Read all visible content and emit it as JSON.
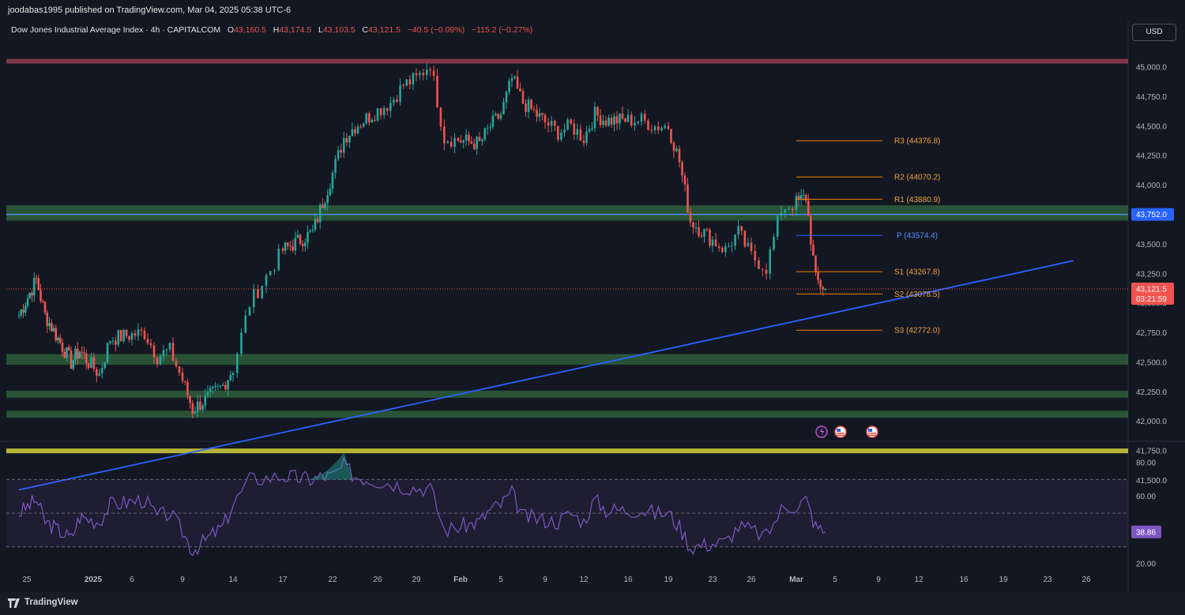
{
  "header": {
    "publisher": "joodabas1995 published on TradingView.com, Mar 04, 2025 05:38 UTC-6"
  },
  "legend": {
    "symbol": "Dow Jones Industrial Average Index · 4h · CAPITALCOM",
    "o_label": "O",
    "o": "43,160.5",
    "h_label": "H",
    "h": "43,174.5",
    "l_label": "L",
    "l": "43,103.5",
    "c_label": "C",
    "c": "43,121.5",
    "change": "−40.5 (−0.09%)",
    "change2": "−115.2 (−0.27%)"
  },
  "currency": "USD",
  "footer": {
    "brand": "TradingView"
  },
  "colors": {
    "up": "#26a69a",
    "down": "#ef5350",
    "trendline": "#2962ff",
    "pivot": "#f57c00",
    "rsi": "#7e57c2",
    "zone_green": "#2e5e3a",
    "zone_yellow": "#c8c43a",
    "zone_red": "#8a3a4a"
  },
  "chart_data": {
    "type": "candlestick",
    "timeframe": "4h",
    "price_axis": {
      "ticks": [
        "45,000.0",
        "44,750.0",
        "44,500.0",
        "44,250.0",
        "44,000.0",
        "43,750.0",
        "43,500.0",
        "43,250.0",
        "43,000.0",
        "42,750.0",
        "42,500.0",
        "42,250.0",
        "42,000.0",
        "41,750.0",
        "41,500.0"
      ],
      "range": [
        41450,
        45120
      ]
    },
    "time_axis": {
      "ticks": [
        "25",
        "2025",
        "6",
        "9",
        "14",
        "17",
        "22",
        "26",
        "29",
        "Feb",
        "5",
        "9",
        "12",
        "16",
        "19",
        "23",
        "26",
        "Mar",
        "5",
        "9",
        "12",
        "16",
        "19",
        "23",
        "26"
      ]
    },
    "last_price": {
      "label": "43,121.5",
      "countdown": "03:21:59",
      "value": 43121.5
    },
    "blue_line_label": {
      "label": "43,752.0",
      "value": 43752
    },
    "pivots": [
      {
        "label": "R3 (44376.8)",
        "value": 44376.8
      },
      {
        "label": "R2 (44070.2)",
        "value": 44070.2
      },
      {
        "label": "R1 (43880.9)",
        "value": 43880.9
      },
      {
        "label": "P (43574.4)",
        "value": 43574.4
      },
      {
        "label": "S1 (43267.8)",
        "value": 43267.8
      },
      {
        "label": "S2 (43078.5)",
        "value": 43078.5
      },
      {
        "label": "S3 (42772.0)",
        "value": 42772.0
      }
    ],
    "zones": [
      {
        "type": "resistance",
        "color": "red",
        "from": 45030,
        "to": 45070
      },
      {
        "type": "support",
        "color": "green",
        "from": 43700,
        "to": 43830
      },
      {
        "type": "support",
        "color": "green",
        "from": 42480,
        "to": 42570
      },
      {
        "type": "support",
        "color": "green",
        "from": 42200,
        "to": 42260
      },
      {
        "type": "support",
        "color": "green",
        "from": 42030,
        "to": 42090
      },
      {
        "type": "support",
        "color": "yellow",
        "from": 41730,
        "to": 41770
      }
    ],
    "trendline": {
      "from": {
        "date": "Dec 24, 2024",
        "price": 41420
      },
      "to": {
        "date": "Mar 25, 2025",
        "price": 43360
      }
    },
    "close_path": [
      [
        "Dec 24",
        42900
      ],
      [
        "Dec 26",
        43200
      ],
      [
        "Dec 27",
        42900
      ],
      [
        "Dec 30",
        42500
      ],
      [
        "Dec 31",
        42600
      ],
      [
        "Jan 2",
        42400
      ],
      [
        "Jan 3",
        42700
      ],
      [
        "Jan 6",
        42750
      ],
      [
        "Jan 7",
        42550
      ],
      [
        "Jan 8",
        42600
      ],
      [
        "Jan 10",
        42100
      ],
      [
        "Jan 13",
        42300
      ],
      [
        "Jan 14",
        42450
      ],
      [
        "Jan 15",
        43000
      ],
      [
        "Jan 17",
        43450
      ],
      [
        "Jan 20",
        43600
      ],
      [
        "Jan 21",
        43850
      ],
      [
        "Jan 22",
        44100
      ],
      [
        "Jan 23",
        44400
      ],
      [
        "Jan 24",
        44500
      ],
      [
        "Jan 27",
        44700
      ],
      [
        "Jan 28",
        44850
      ],
      [
        "Jan 29",
        44900
      ],
      [
        "Jan 30",
        45030
      ],
      [
        "Jan 31",
        44400
      ],
      [
        "Feb 3",
        44350
      ],
      [
        "Feb 4",
        44500
      ],
      [
        "Feb 5",
        44600
      ],
      [
        "Feb 6",
        44900
      ],
      [
        "Feb 7",
        44700
      ],
      [
        "Feb 10",
        44450
      ],
      [
        "Feb 11",
        44500
      ],
      [
        "Feb 12",
        44400
      ],
      [
        "Feb 13",
        44600
      ],
      [
        "Feb 14",
        44550
      ],
      [
        "Feb 17",
        44550
      ],
      [
        "Feb 18",
        44500
      ],
      [
        "Feb 19",
        44500
      ],
      [
        "Feb 20",
        44200
      ],
      [
        "Feb 21",
        43700
      ],
      [
        "Feb 24",
        43450
      ],
      [
        "Feb 25",
        43600
      ],
      [
        "Feb 26",
        43400
      ],
      [
        "Feb 27",
        43300
      ],
      [
        "Feb 28",
        43800
      ],
      [
        "Mar 2",
        43900
      ],
      [
        "Mar 3",
        43200
      ],
      [
        "Mar 4",
        43121.5
      ]
    ],
    "rsi": {
      "ticks": [
        "80.00",
        "60.00",
        "20.00"
      ],
      "range": [
        15,
        88
      ],
      "bands": {
        "upper": 70,
        "middle": 50,
        "lower": 30
      },
      "value_label": "38.86",
      "values": [
        [
          "Dec 24",
          50
        ],
        [
          "Dec 26",
          58
        ],
        [
          "Dec 27",
          45
        ],
        [
          "Dec 30",
          35
        ],
        [
          "Dec 31",
          48
        ],
        [
          "Jan 2",
          45
        ],
        [
          "Jan 3",
          55
        ],
        [
          "Jan 6",
          58
        ],
        [
          "Jan 7",
          48
        ],
        [
          "Jan 8",
          50
        ],
        [
          "Jan 10",
          28
        ],
        [
          "Jan 13",
          42
        ],
        [
          "Jan 14",
          55
        ],
        [
          "Jan 15",
          70
        ],
        [
          "Jan 17",
          72
        ],
        [
          "Jan 20",
          70
        ],
        [
          "Jan 21",
          72
        ],
        [
          "Jan 22",
          72
        ],
        [
          "Jan 23",
          78
        ],
        [
          "Jan 24",
          72
        ],
        [
          "Jan 27",
          68
        ],
        [
          "Jan 28",
          66
        ],
        [
          "Jan 29",
          65
        ],
        [
          "Jan 30",
          65
        ],
        [
          "Jan 31",
          40
        ],
        [
          "Feb 3",
          45
        ],
        [
          "Feb 4",
          52
        ],
        [
          "Feb 5",
          55
        ],
        [
          "Feb 6",
          62
        ],
        [
          "Feb 7",
          48
        ],
        [
          "Feb 10",
          45
        ],
        [
          "Feb 11",
          50
        ],
        [
          "Feb 12",
          45
        ],
        [
          "Feb 13",
          58
        ],
        [
          "Feb 14",
          52
        ],
        [
          "Feb 17",
          52
        ],
        [
          "Feb 18",
          50
        ],
        [
          "Feb 19",
          50
        ],
        [
          "Feb 20",
          42
        ],
        [
          "Feb 21",
          30
        ],
        [
          "Feb 24",
          33
        ],
        [
          "Feb 25",
          42
        ],
        [
          "Feb 26",
          40
        ],
        [
          "Feb 27",
          36
        ],
        [
          "Feb 28",
          52
        ],
        [
          "Mar 2",
          58
        ],
        [
          "Mar 3",
          42
        ],
        [
          "Mar 4",
          38.86
        ]
      ]
    }
  }
}
